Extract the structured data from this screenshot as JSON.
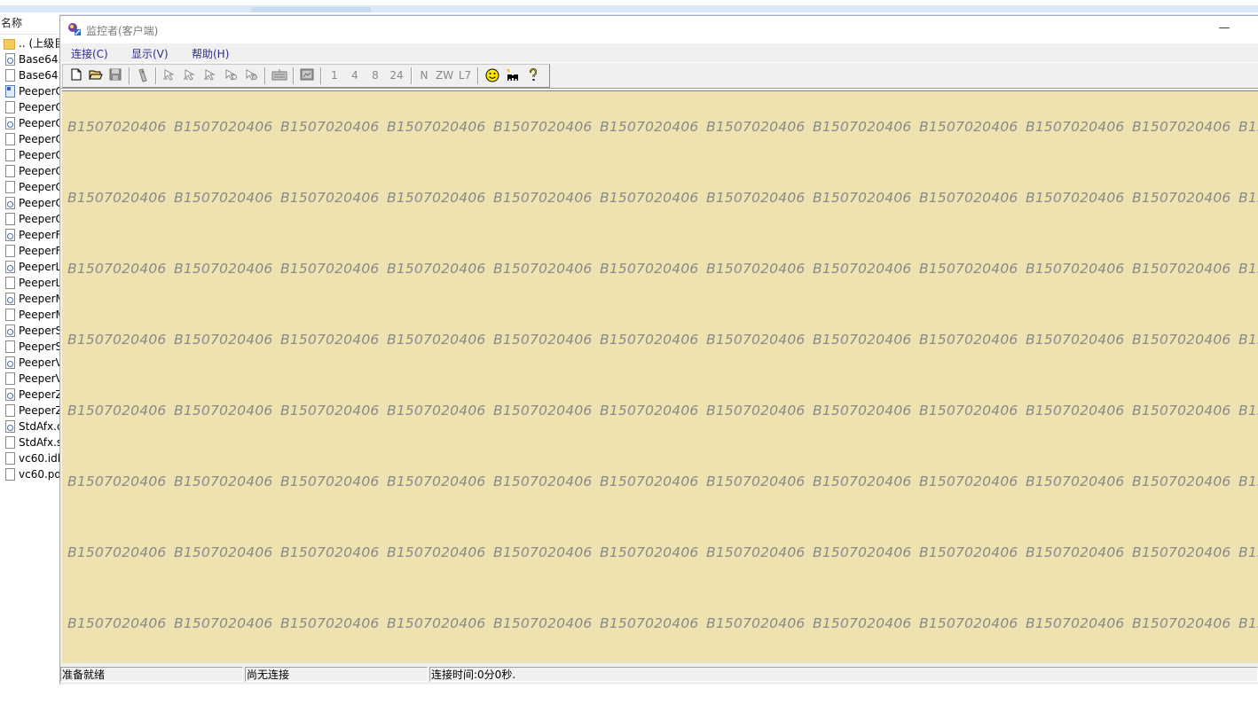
{
  "explorer": {
    "header": "名称",
    "items": [
      {
        "name": ".. (上级目",
        "icon": "folder-icon"
      },
      {
        "name": "Base64.",
        "icon": "source-file-icon"
      },
      {
        "name": "Base64.",
        "icon": "file-icon"
      },
      {
        "name": "PeeperC",
        "icon": "app-file-icon"
      },
      {
        "name": "PeeperC",
        "icon": "file-icon"
      },
      {
        "name": "PeeperC",
        "icon": "source-file-icon"
      },
      {
        "name": "PeeperC",
        "icon": "file-icon"
      },
      {
        "name": "PeeperC",
        "icon": "file-icon"
      },
      {
        "name": "PeeperC",
        "icon": "file-icon"
      },
      {
        "name": "PeeperC",
        "icon": "file-icon"
      },
      {
        "name": "PeeperC",
        "icon": "source-file-icon"
      },
      {
        "name": "PeeperC",
        "icon": "file-icon"
      },
      {
        "name": "PeeperF",
        "icon": "source-file-icon"
      },
      {
        "name": "PeeperF",
        "icon": "file-icon"
      },
      {
        "name": "PeeperL",
        "icon": "source-file-icon"
      },
      {
        "name": "PeeperL",
        "icon": "file-icon"
      },
      {
        "name": "PeeperM",
        "icon": "source-file-icon"
      },
      {
        "name": "PeeperM",
        "icon": "file-icon"
      },
      {
        "name": "PeeperS",
        "icon": "source-file-icon"
      },
      {
        "name": "PeeperS",
        "icon": "file-icon"
      },
      {
        "name": "PeeperV",
        "icon": "source-file-icon"
      },
      {
        "name": "PeeperV",
        "icon": "file-icon"
      },
      {
        "name": "PeeperZ",
        "icon": "source-file-icon"
      },
      {
        "name": "PeeperZ",
        "icon": "file-icon"
      },
      {
        "name": "StdAfx.c",
        "icon": "source-file-icon"
      },
      {
        "name": "StdAfx.s",
        "icon": "file-icon"
      },
      {
        "name": "vc60.idb",
        "icon": "file-icon"
      },
      {
        "name": "vc60.pdl",
        "icon": "file-icon"
      }
    ]
  },
  "window": {
    "title": "监控者(客户端)",
    "minimize_label": "—",
    "menu": {
      "connect": "连接(C)",
      "view": "显示(V)",
      "help": "帮助(H)"
    },
    "toolbar": {
      "new_icon": "new-file-icon",
      "open_icon": "open-folder-icon",
      "save_icon": "save-disk-icon",
      "scale_1": "1",
      "scale_4": "4",
      "scale_8": "8",
      "scale_24": "24",
      "mode_n": "N",
      "mode_zw": "ZW",
      "mode_l7": "L7",
      "smiley_icon": "smiley-icon",
      "connect_icon": "binoculars-icon",
      "help_icon": "help-question-icon"
    },
    "watermark": {
      "text": "B1507020406",
      "color": "#8a8a8a",
      "background": "#ede2b0"
    },
    "status": {
      "ready": "准备就绪",
      "connection": "尚无连接",
      "connect_time": "连接时间:0分0秒."
    }
  }
}
